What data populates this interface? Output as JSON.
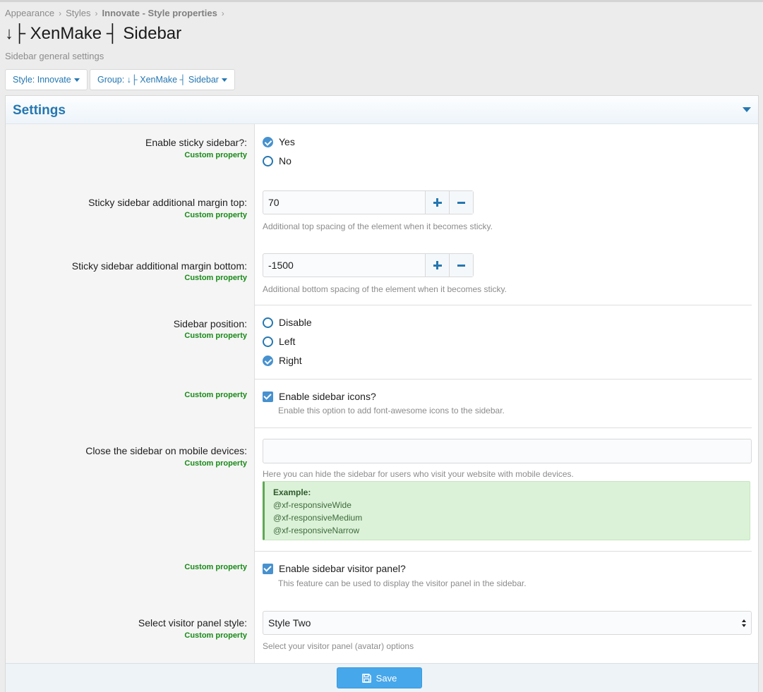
{
  "breadcrumb": [
    "Appearance",
    "Styles",
    "Innovate - Style properties"
  ],
  "page": {
    "title": "↓├ XenMake ┤ Sidebar",
    "description": "Sidebar general settings"
  },
  "filters": {
    "style": "Style: Innovate",
    "group": "Group: ↓├ XenMake ┤ Sidebar"
  },
  "panel": {
    "title": "Settings"
  },
  "custom_property_label": "Custom property",
  "settings": {
    "sticky": {
      "label": "Enable sticky sidebar?:",
      "options": [
        "Yes",
        "No"
      ],
      "selected": "Yes"
    },
    "margin_top": {
      "label": "Sticky sidebar additional margin top:",
      "value": "70",
      "hint": "Additional top spacing of the element when it becomes sticky."
    },
    "margin_bottom": {
      "label": "Sticky sidebar additional margin bottom:",
      "value": "-1500",
      "hint": "Additional bottom spacing of the element when it becomes sticky."
    },
    "position": {
      "label": "Sidebar position:",
      "options": [
        "Disable",
        "Left",
        "Right"
      ],
      "selected": "Right"
    },
    "icons": {
      "label": "Enable sidebar icons?",
      "checked": true,
      "hint": "Enable this option to add font-awesome icons to the sidebar."
    },
    "mobile": {
      "label": "Close the sidebar on mobile devices:",
      "value": "",
      "hint": "Here you can hide the sidebar for users who visit your website with mobile devices.",
      "example_title": "Example:",
      "examples": [
        "@xf-responsiveWide",
        "@xf-responsiveMedium",
        "@xf-responsiveNarrow"
      ]
    },
    "visitor_panel": {
      "label": "Enable sidebar visitor panel?",
      "checked": true,
      "hint": "This feature can be used to display the visitor panel in the sidebar."
    },
    "visitor_style": {
      "label": "Select visitor panel style:",
      "selected": "Style Two",
      "hint": "Select your visitor panel (avatar) options"
    }
  },
  "footer": {
    "save_label": "Save"
  },
  "colors": {
    "accent": "#2577b1",
    "button": "#47a7eb",
    "custom_property": "#188a18",
    "example_bg": "#dbf2d8"
  },
  "icons": {
    "toggle": "caret-down-icon",
    "save": "floppy-disk-icon",
    "step_up": "plus-icon",
    "step_down": "minus-icon"
  }
}
